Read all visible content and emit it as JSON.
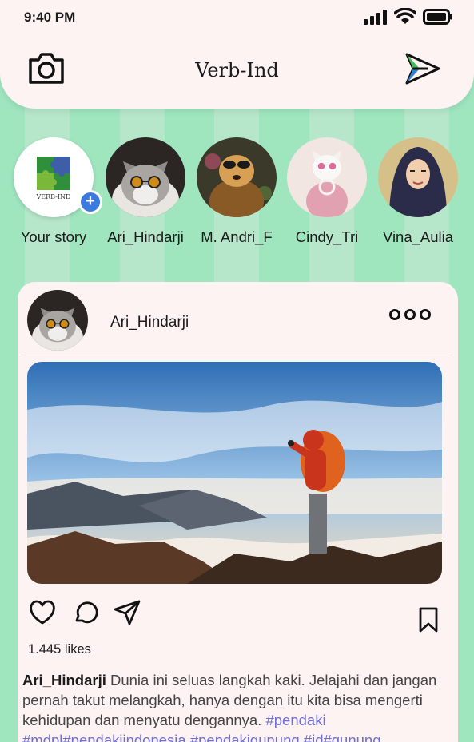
{
  "status": {
    "time": "9:40 PM"
  },
  "header": {
    "title": "Verb-Ind"
  },
  "stories": [
    {
      "name": "Your story",
      "logo_text": "VERB-IND"
    },
    {
      "name": "Ari_Hindarji"
    },
    {
      "name": "M. Andri_F"
    },
    {
      "name": "Cindy_Tri"
    },
    {
      "name": "Vina_Aulia"
    }
  ],
  "post": {
    "username": "Ari_Hindarji",
    "likes": "1.445 likes",
    "caption_user": "Ari_Hindarji",
    "caption_text": " Dunia ini seluas langkah kaki. Jelajahi dan jangan pernah takut melangkah, hanya dengan itu kita bisa mengerti kehidupan dan menyatu dengannya. ",
    "hashtags": "#pendaki #mdpl#pendakiindonesia #pendakigunung #id#gunung"
  },
  "colors": {
    "background": "#9fe6bf",
    "surface": "#fdf3f3",
    "accent": "#3b7be0",
    "hashtag": "#6f6fd8"
  },
  "icons": [
    "camera-icon",
    "send-icon",
    "heart-icon",
    "comment-icon",
    "share-icon",
    "bookmark-icon",
    "more-icon",
    "plus-icon"
  ]
}
